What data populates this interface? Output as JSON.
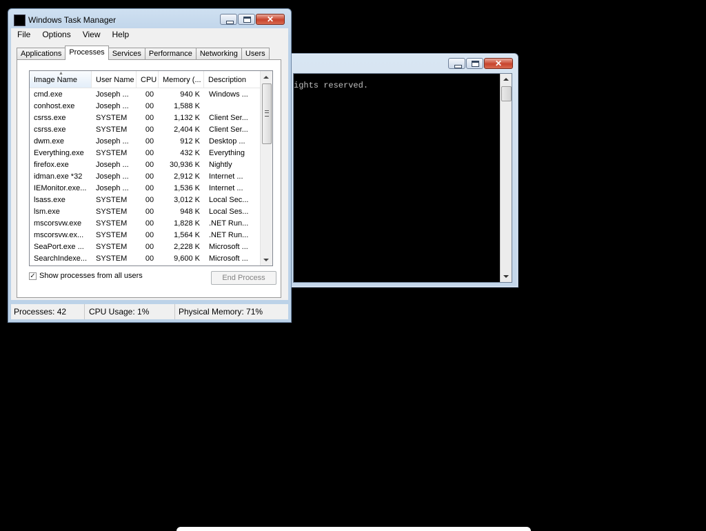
{
  "console": {
    "visible_text": "ights reserved."
  },
  "task_manager": {
    "title": "Windows Task Manager",
    "menu": [
      "File",
      "Options",
      "View",
      "Help"
    ],
    "tabs": [
      "Applications",
      "Processes",
      "Services",
      "Performance",
      "Networking",
      "Users"
    ],
    "active_tab": "Processes",
    "columns": [
      "Image Name",
      "User Name",
      "CPU",
      "Memory (...",
      "Description"
    ],
    "sorted_column": "Image Name",
    "rows": [
      {
        "name": "cmd.exe",
        "user": "Joseph ...",
        "cpu": "00",
        "mem": "940 K",
        "desc": "Windows ..."
      },
      {
        "name": "conhost.exe",
        "user": "Joseph ...",
        "cpu": "00",
        "mem": "1,588 K",
        "desc": ""
      },
      {
        "name": "csrss.exe",
        "user": "SYSTEM",
        "cpu": "00",
        "mem": "1,132 K",
        "desc": "Client Ser..."
      },
      {
        "name": "csrss.exe",
        "user": "SYSTEM",
        "cpu": "00",
        "mem": "2,404 K",
        "desc": "Client Ser..."
      },
      {
        "name": "dwm.exe",
        "user": "Joseph ...",
        "cpu": "00",
        "mem": "912 K",
        "desc": "Desktop ..."
      },
      {
        "name": "Everything.exe",
        "user": "SYSTEM",
        "cpu": "00",
        "mem": "432 K",
        "desc": "Everything"
      },
      {
        "name": "firefox.exe",
        "user": "Joseph ...",
        "cpu": "00",
        "mem": "30,936 K",
        "desc": "Nightly"
      },
      {
        "name": "idman.exe *32",
        "user": "Joseph ...",
        "cpu": "00",
        "mem": "2,912 K",
        "desc": "Internet ..."
      },
      {
        "name": "IEMonitor.exe...",
        "user": "Joseph ...",
        "cpu": "00",
        "mem": "1,536 K",
        "desc": "Internet ..."
      },
      {
        "name": "lsass.exe",
        "user": "SYSTEM",
        "cpu": "00",
        "mem": "3,012 K",
        "desc": "Local Sec..."
      },
      {
        "name": "lsm.exe",
        "user": "SYSTEM",
        "cpu": "00",
        "mem": "948 K",
        "desc": "Local Ses..."
      },
      {
        "name": "mscorsvw.exe",
        "user": "SYSTEM",
        "cpu": "00",
        "mem": "1,828 K",
        "desc": ".NET Run..."
      },
      {
        "name": "mscorsvw.ex...",
        "user": "SYSTEM",
        "cpu": "00",
        "mem": "1,564 K",
        "desc": ".NET Run..."
      },
      {
        "name": "SeaPort.exe ...",
        "user": "SYSTEM",
        "cpu": "00",
        "mem": "2,228 K",
        "desc": "Microsoft ..."
      },
      {
        "name": "SearchIndexe...",
        "user": "SYSTEM",
        "cpu": "00",
        "mem": "9,600 K",
        "desc": "Microsoft ..."
      }
    ],
    "show_all_label": "Show processes from all users",
    "show_all_checked": true,
    "end_process_label": "End Process",
    "status": {
      "processes": "Processes: 42",
      "cpu": "CPU Usage: 1%",
      "memory": "Physical Memory: 71%"
    },
    "icons": {
      "minimize": "minimize-icon",
      "maximize": "maximize-icon",
      "close": "close-icon",
      "checkmark": "✓"
    }
  }
}
